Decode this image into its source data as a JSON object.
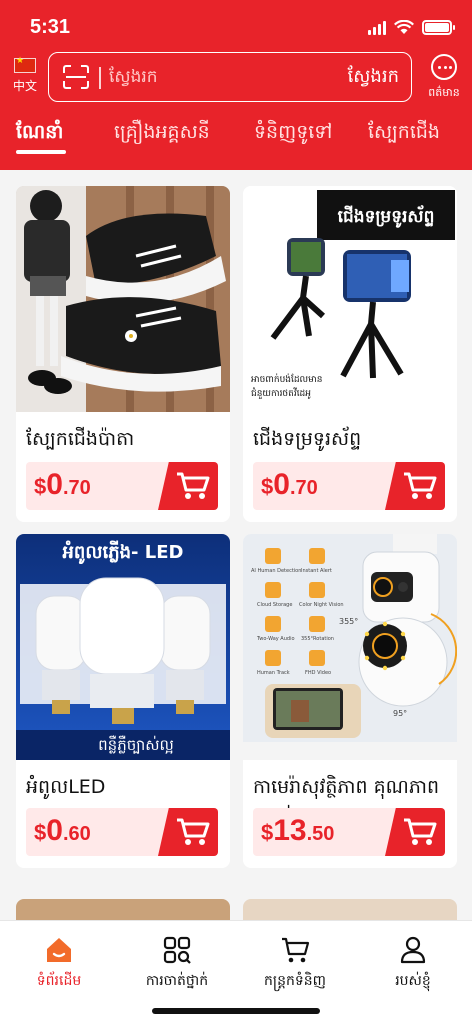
{
  "status_bar": {
    "time": "5:31"
  },
  "header": {
    "language_label": "中文",
    "search": {
      "placeholder": "ស្វែងរក",
      "button_label": "ស្វែងរក"
    },
    "message_label": "ពត៌មាន"
  },
  "tabs": [
    {
      "label": "ណែនាំ",
      "active": true
    },
    {
      "label": "គ្រឿងអគ្គសនី",
      "active": false
    },
    {
      "label": "ទំនិញទូទៅ",
      "active": false
    },
    {
      "label": "ស្បែកជើង",
      "active": false
    }
  ],
  "products": [
    {
      "title": "ស្បែកជើងប៉ាតា",
      "price": {
        "currency": "$",
        "integer": "0",
        "decimal": ".70"
      }
    },
    {
      "title": "ជើងទម្រទូរស័ព្ទ",
      "price": {
        "currency": "$",
        "integer": "0",
        "decimal": ".70"
      },
      "image_text": "ជើងទម្រទូរស័ព្ទ",
      "image_caption_1": "អាចពាក់បង់ដែលមាន",
      "image_caption_2": "ជំនួយការថតវីដេអូ"
    },
    {
      "title": "អំពូលLED",
      "price": {
        "currency": "$",
        "integer": "0",
        "decimal": ".60"
      },
      "image_text": "អំពូលភ្លើង- LED",
      "image_footer": "ពន្លឺភ្លឺច្បាស់ល្អ"
    },
    {
      "title": "កាមេរ៉ាសុវត្ថិភាព គុណភាពច្បាស់ HD",
      "price": {
        "currency": "$",
        "integer": "13",
        "decimal": ".50"
      },
      "image_labels": [
        "AI Human Detection",
        "Instant Alert",
        "Cloud Storage",
        "Color Night Vision",
        "Two-Way Audio",
        "355°Rotation",
        "Human Track",
        "FHD Video"
      ],
      "angle_1": "355°",
      "angle_2": "95°"
    }
  ],
  "bottom_nav": [
    {
      "label": "ទំព័រដើម",
      "icon": "home-icon",
      "active": true
    },
    {
      "label": "ការចាត់ថ្នាក់",
      "icon": "category-icon",
      "active": false
    },
    {
      "label": "កន្ត្រកទំនិញ",
      "icon": "cart-icon",
      "active": false
    },
    {
      "label": "របស់ខ្ញុំ",
      "icon": "user-icon",
      "active": false
    }
  ],
  "colors": {
    "brand": "#e8232a",
    "price_bg": "#ffe9e9",
    "background": "#f4f4f4"
  }
}
